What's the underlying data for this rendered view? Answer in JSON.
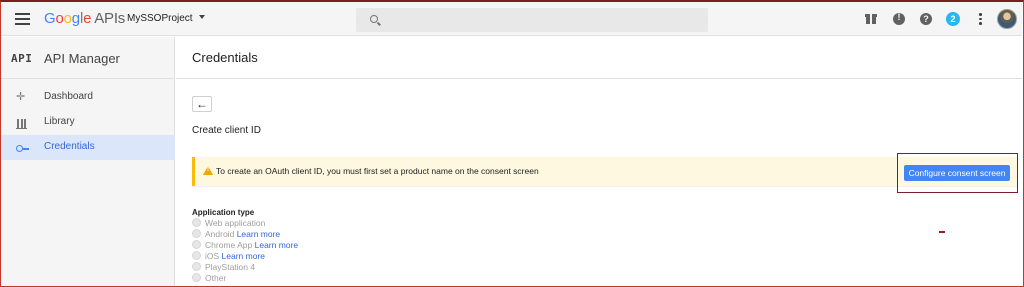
{
  "topbar": {
    "logo_word": "Google",
    "logo_suffix": "APIs",
    "project_name": "MySSOProject",
    "search_placeholder": "",
    "help_glyph": "?",
    "notification_count": "2",
    "icons": [
      "menu-icon",
      "search-icon",
      "gift-icon",
      "comment-icon",
      "help-icon",
      "more-vert-icon"
    ]
  },
  "sidebar": {
    "glyph": "API",
    "title": "API Manager",
    "items": [
      {
        "label": "Dashboard",
        "icon": "dashboard-icon",
        "active": false
      },
      {
        "label": "Library",
        "icon": "library-icon",
        "active": false
      },
      {
        "label": "Credentials",
        "icon": "key-icon",
        "active": true
      }
    ]
  },
  "main": {
    "title": "Credentials",
    "back_glyph": "←",
    "subtitle": "Create client ID",
    "warning": "To create an OAuth client ID, you must first set a product name on the consent screen",
    "consent_button": "Configure consent screen",
    "app_type_label": "Application type",
    "app_types": [
      {
        "label": "Web application",
        "link": ""
      },
      {
        "label": "Android",
        "link": "Learn more"
      },
      {
        "label": "Chrome App",
        "link": "Learn more"
      },
      {
        "label": "iOS",
        "link": "Learn more"
      },
      {
        "label": "PlayStation 4",
        "link": ""
      },
      {
        "label": "Other",
        "link": ""
      }
    ]
  },
  "colors": {
    "accent": "#4285f4",
    "warning_bg": "#fff8e1",
    "warning_border": "#fbbc05",
    "highlight": "#7a1f2b",
    "badge": "#29b6f6"
  }
}
